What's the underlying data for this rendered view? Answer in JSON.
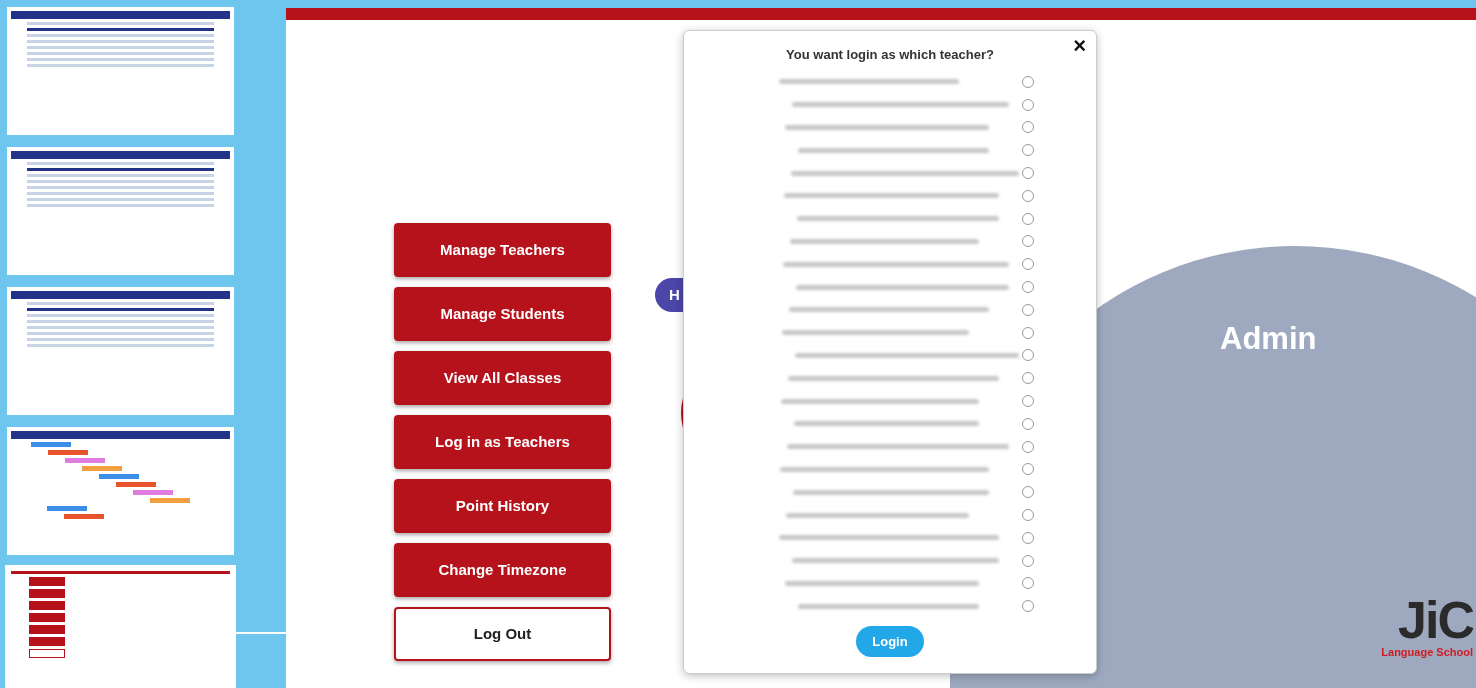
{
  "slides": [
    {
      "kind": "table",
      "selected": false
    },
    {
      "kind": "table",
      "selected": false
    },
    {
      "kind": "table",
      "selected": false
    },
    {
      "kind": "calendar",
      "selected": false
    },
    {
      "kind": "menu",
      "selected": true
    }
  ],
  "menu": [
    {
      "label": "Manage Teachers",
      "kind": "filled"
    },
    {
      "label": "Manage Students",
      "kind": "filled"
    },
    {
      "label": "View All Classes",
      "kind": "filled"
    },
    {
      "label": "Log in as Teachers",
      "kind": "filled"
    },
    {
      "label": "Point History",
      "kind": "filled"
    },
    {
      "label": "Change Timezone",
      "kind": "filled"
    },
    {
      "label": "Log Out",
      "kind": "outline"
    }
  ],
  "hidden_badge": {
    "label": "H"
  },
  "role_panel": {
    "title": "Admin"
  },
  "logo": {
    "mark": "JiC",
    "tagline": "Language School"
  },
  "dialog": {
    "close": "×",
    "title": "You want login as which teacher?",
    "button": "Login",
    "teachers": [
      {
        "selected": false
      },
      {
        "selected": false
      },
      {
        "selected": false
      },
      {
        "selected": false
      },
      {
        "selected": false
      },
      {
        "selected": false
      },
      {
        "selected": false
      },
      {
        "selected": false
      },
      {
        "selected": false
      },
      {
        "selected": false
      },
      {
        "selected": false
      },
      {
        "selected": false
      },
      {
        "selected": false
      },
      {
        "selected": false
      },
      {
        "selected": false
      },
      {
        "selected": false
      },
      {
        "selected": false
      },
      {
        "selected": false
      },
      {
        "selected": false
      },
      {
        "selected": false
      },
      {
        "selected": false
      },
      {
        "selected": false
      },
      {
        "selected": false
      },
      {
        "selected": false
      }
    ]
  }
}
